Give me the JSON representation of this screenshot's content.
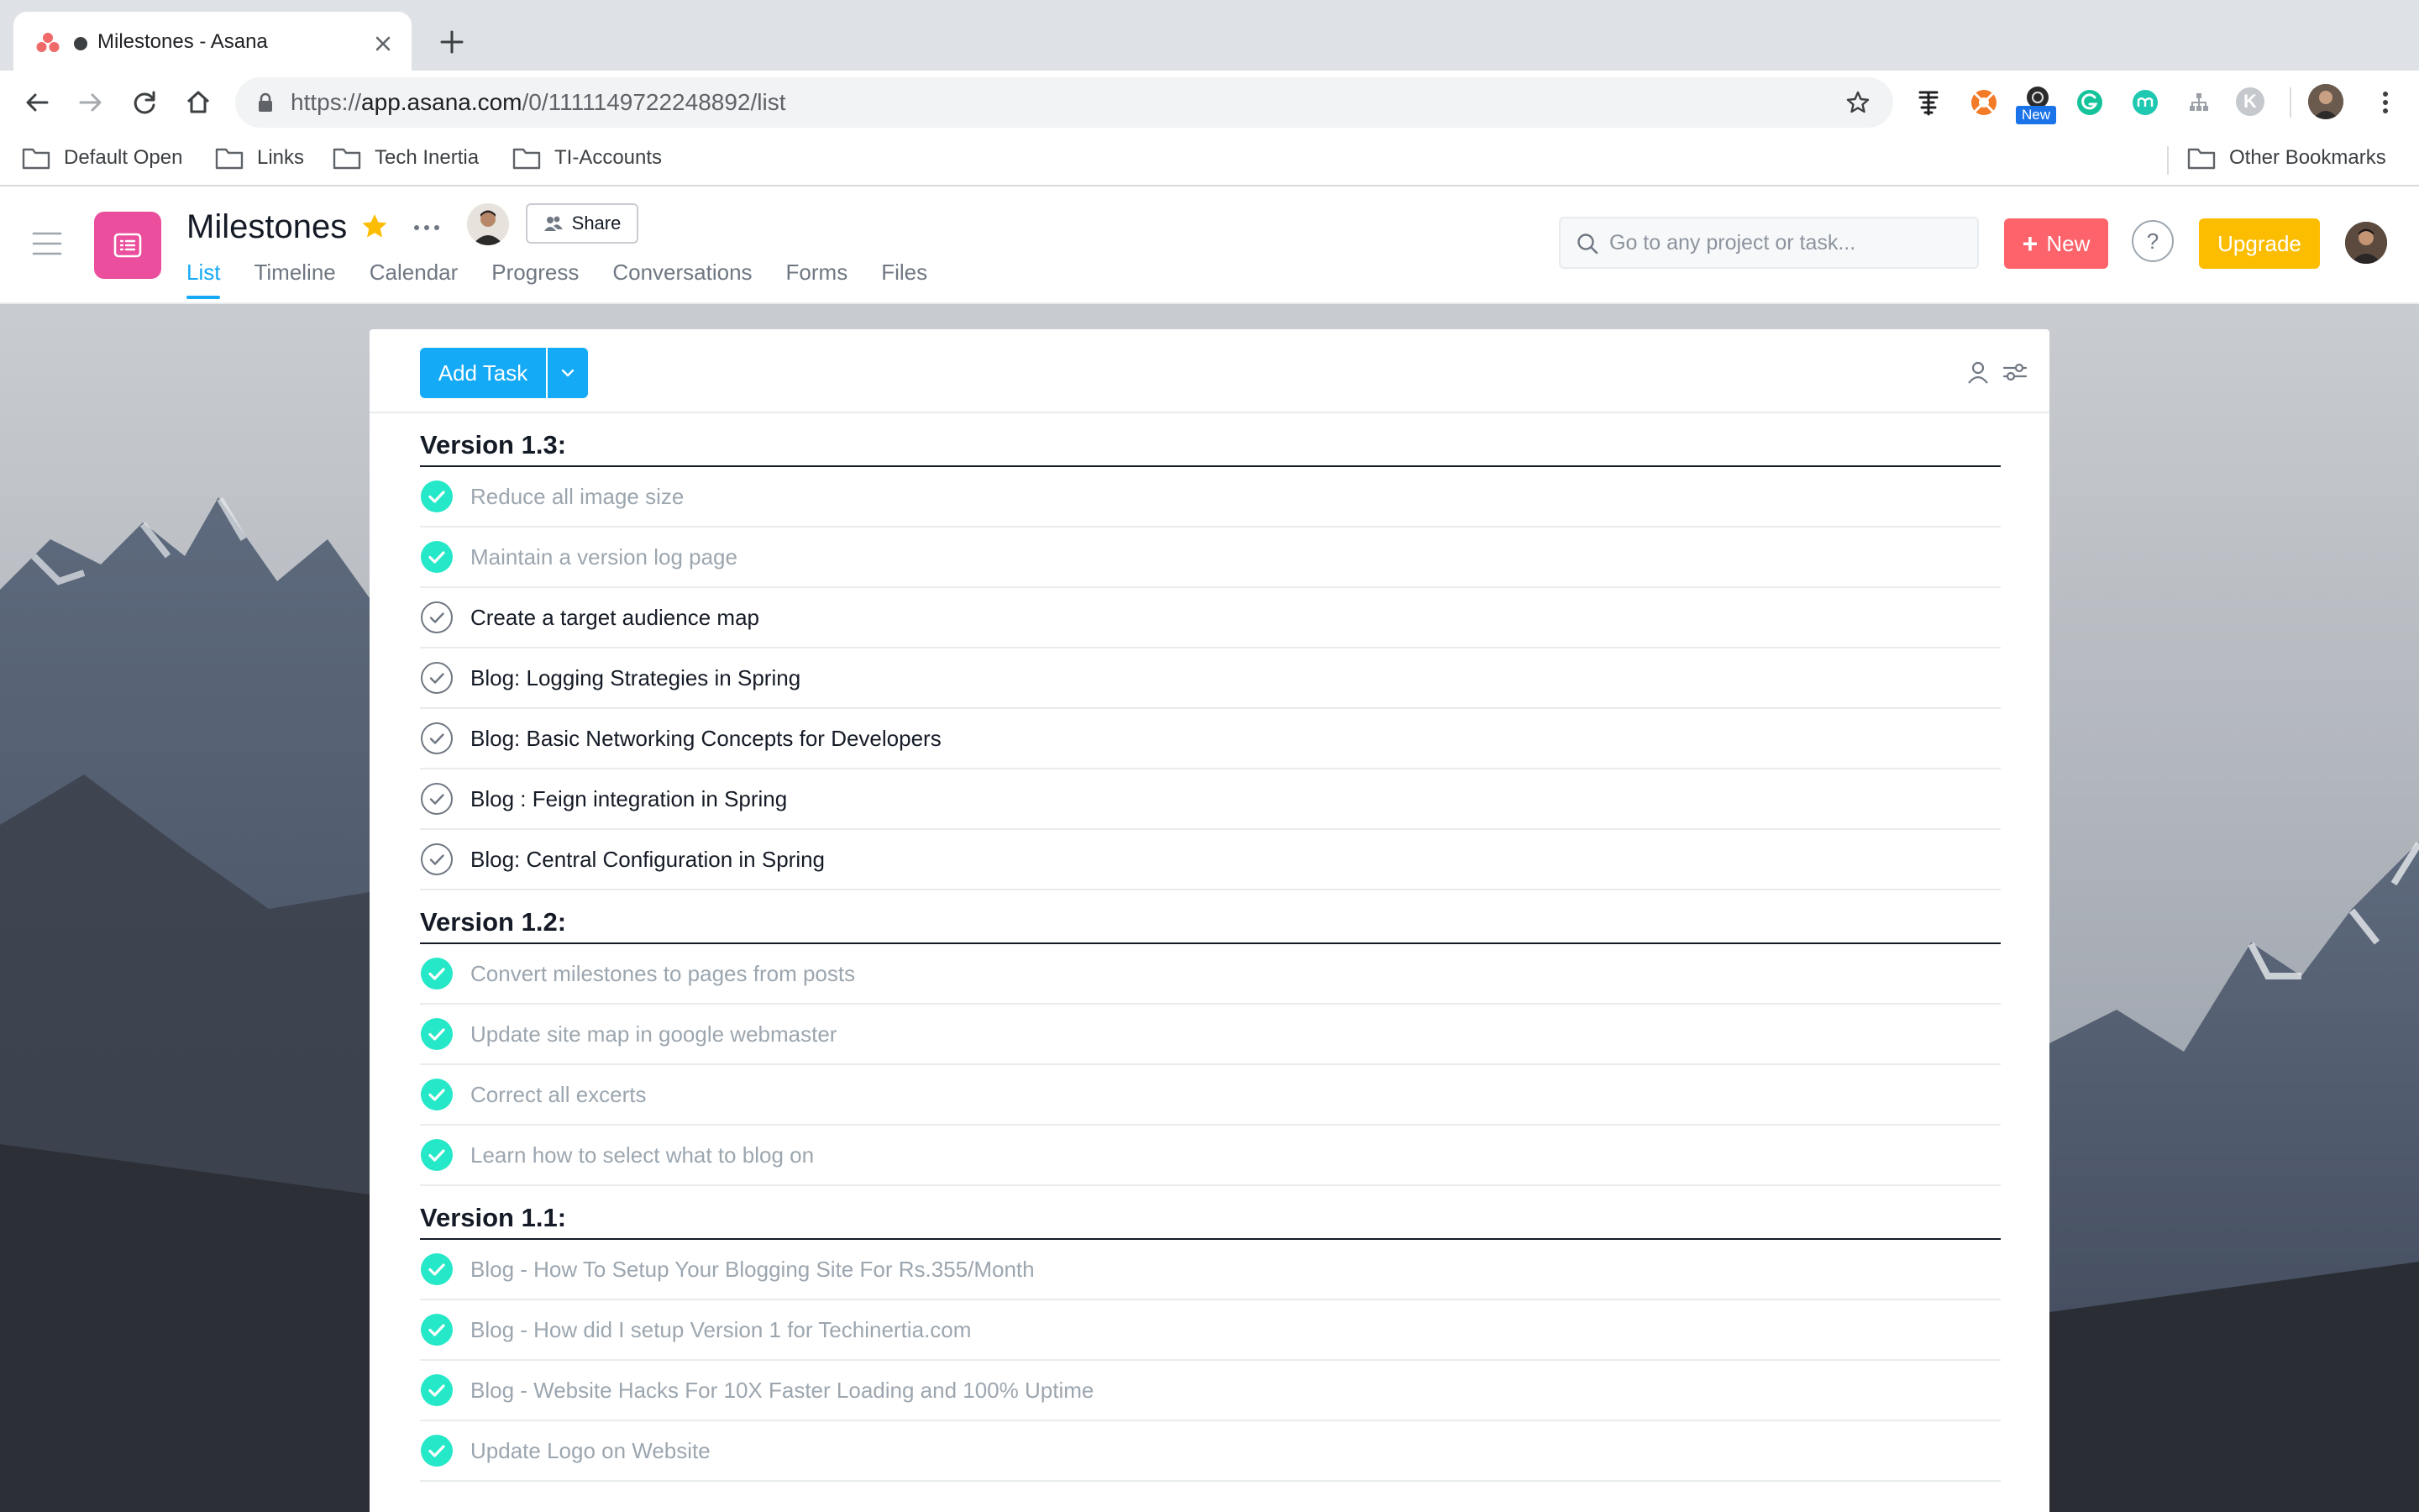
{
  "browser": {
    "tab_title": "Milestones - Asana",
    "url_scheme": "https://",
    "url_host": "app.asana.com",
    "url_path": "/0/1111149722248892/list",
    "extension_badge": "New",
    "extension_letter": "K"
  },
  "bookmarks": {
    "items": [
      "Default Open",
      "Links",
      "Tech Inertia",
      "TI-Accounts"
    ],
    "other": "Other Bookmarks"
  },
  "header": {
    "project_title": "Milestones",
    "share_label": "Share",
    "tabs": [
      "List",
      "Timeline",
      "Calendar",
      "Progress",
      "Conversations",
      "Forms",
      "Files"
    ],
    "active_tab": "List",
    "search_placeholder": "Go to any project or task...",
    "new_label": "New",
    "help_label": "?",
    "upgrade_label": "Upgrade"
  },
  "list": {
    "add_task_label": "Add Task",
    "sections": [
      {
        "title": "Version 1.3:",
        "tasks": [
          {
            "name": "Reduce all image size",
            "done": true
          },
          {
            "name": "Maintain a version log page",
            "done": true
          },
          {
            "name": "Create a target audience map",
            "done": false
          },
          {
            "name": "Blog: Logging Strategies in Spring",
            "done": false
          },
          {
            "name": "Blog: Basic Networking Concepts for Developers",
            "done": false
          },
          {
            "name": "Blog : Feign integration in Spring",
            "done": false
          },
          {
            "name": "Blog: Central Configuration in Spring",
            "done": false
          }
        ]
      },
      {
        "title": "Version 1.2:",
        "tasks": [
          {
            "name": "Convert milestones to pages from posts",
            "done": true
          },
          {
            "name": "Update site map in google webmaster",
            "done": true
          },
          {
            "name": "Correct all excerts",
            "done": true
          },
          {
            "name": "Learn how to select what to blog on",
            "done": true
          }
        ]
      },
      {
        "title": "Version 1.1:",
        "tasks": [
          {
            "name": "Blog - How To Setup Your Blogging Site For Rs.355/Month",
            "done": true
          },
          {
            "name": "Blog - How did I setup Version 1 for Techinertia.com",
            "done": true
          },
          {
            "name": "Blog - Website Hacks For 10X Faster Loading and 100% Uptime",
            "done": true
          },
          {
            "name": "Update Logo on Website",
            "done": true
          }
        ]
      }
    ]
  },
  "colors": {
    "accent_blue": "#14aaf5",
    "done_green": "#25e8c8",
    "project_pink": "#ea4e9d",
    "new_button": "#fc636b",
    "upgrade_button": "#fcbd01"
  }
}
